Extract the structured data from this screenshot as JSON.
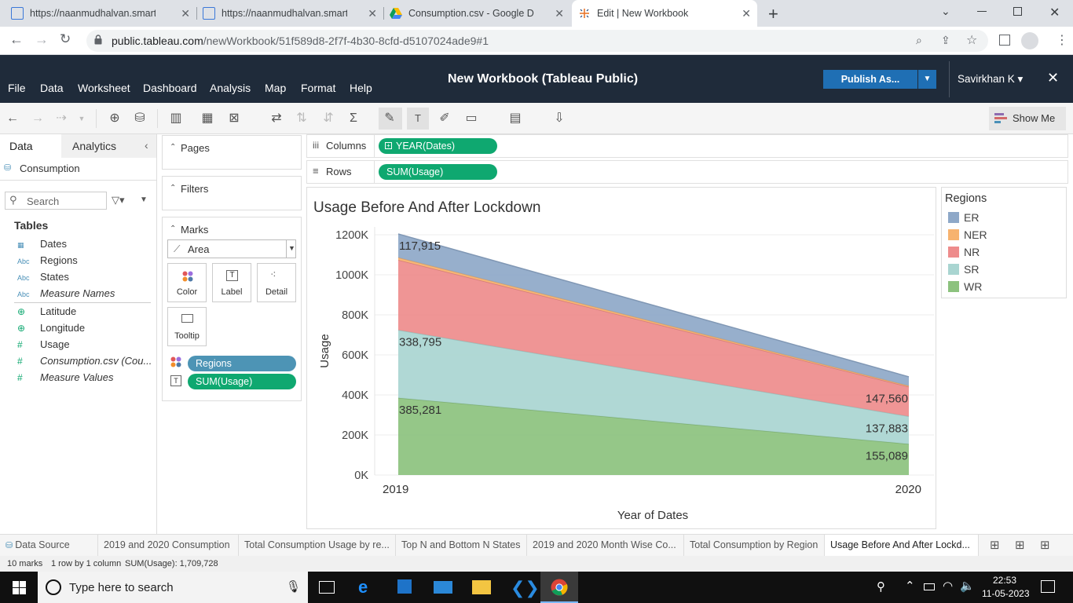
{
  "browser": {
    "tabs": [
      {
        "title": "https://naanmudhalvan.smartinte"
      },
      {
        "title": "https://naanmudhalvan.smartinte"
      },
      {
        "title": "Consumption.csv - Google Drive"
      },
      {
        "title": "Edit | New Workbook"
      }
    ],
    "url_domain": "public.tableau.com",
    "url_path": "/newWorkbook/51f589d8-2f7f-4b30-8cfd-d5107024ade9#1"
  },
  "app": {
    "title": "New Workbook (Tableau Public)",
    "publish_label": "Publish As...",
    "user": "Savirkhan K",
    "menu": [
      "File",
      "Data",
      "Worksheet",
      "Dashboard",
      "Analysis",
      "Map",
      "Format",
      "Help"
    ],
    "show_me": "Show Me"
  },
  "datapane": {
    "tab_data": "Data",
    "tab_analytics": "Analytics",
    "source": "Consumption",
    "search_placeholder": "Search",
    "tables_label": "Tables",
    "fields": [
      {
        "name": "Dates",
        "type": "date"
      },
      {
        "name": "Regions",
        "type": "Abc"
      },
      {
        "name": "States",
        "type": "Abc"
      },
      {
        "name": "Measure Names",
        "type": "Abc",
        "italic": true
      },
      {
        "name": "Latitude",
        "type": "geo"
      },
      {
        "name": "Longitude",
        "type": "geo"
      },
      {
        "name": "Usage",
        "type": "#"
      },
      {
        "name": "Consumption.csv (Cou...",
        "type": "#",
        "italic": true
      },
      {
        "name": "Measure Values",
        "type": "#",
        "italic": true
      }
    ]
  },
  "cards": {
    "pages": "Pages",
    "filters": "Filters",
    "marks": "Marks",
    "mark_type": "Area",
    "buttons": {
      "color": "Color",
      "label": "Label",
      "detail": "Detail",
      "tooltip": "Tooltip"
    },
    "pill_regions": "Regions",
    "pill_usage": "SUM(Usage)"
  },
  "shelves": {
    "columns_label": "Columns",
    "columns_pill": "YEAR(Dates)",
    "rows_label": "Rows",
    "rows_pill": "SUM(Usage)"
  },
  "colors": {
    "pill_green": "#0fa870",
    "pill_blue": "#4d94b5",
    "header_bg": "#1f2b3a",
    "publish_blue": "#1f6fb4"
  },
  "chart_data": {
    "type": "area",
    "title": "Usage Before  And After Lockdown",
    "xlabel": "Year of Dates",
    "ylabel": "Usage",
    "ylim": [
      0,
      1200000
    ],
    "yticks": [
      "0K",
      "200K",
      "400K",
      "600K",
      "800K",
      "1000K",
      "1200K"
    ],
    "categories": [
      "2019",
      "2020"
    ],
    "stacked": true,
    "series": [
      {
        "name": "WR",
        "color": "#8cc27e",
        "values": [
          385281,
          155089
        ],
        "labels": [
          "385,281",
          "155,089"
        ]
      },
      {
        "name": "SR",
        "color": "#a9d5d1",
        "values": [
          338795,
          137883
        ],
        "labels": [
          "338,795",
          "137,883"
        ]
      },
      {
        "name": "NR",
        "color": "#ee8c8c",
        "values": [
          350000,
          147560
        ],
        "labels": [
          "",
          "147,560"
        ]
      },
      {
        "name": "NER",
        "color": "#f7b36f",
        "values": [
          12000,
          5000
        ],
        "labels": [
          "",
          ""
        ]
      },
      {
        "name": "ER",
        "color": "#8ea8c8",
        "values": [
          117915,
          45000
        ],
        "labels": [
          "117,915",
          ""
        ]
      }
    ],
    "legend": {
      "title": "Regions",
      "items": [
        {
          "name": "ER",
          "color": "#8ea8c8"
        },
        {
          "name": "NER",
          "color": "#f7b36f"
        },
        {
          "name": "NR",
          "color": "#ee8c8c"
        },
        {
          "name": "SR",
          "color": "#a9d5d1"
        },
        {
          "name": "WR",
          "color": "#8cc27e"
        }
      ]
    }
  },
  "sheets": [
    {
      "label": "Data Source"
    },
    {
      "label": "2019 and 2020 Consumption"
    },
    {
      "label": "Total Consumption Usage by re..."
    },
    {
      "label": "Top N and Bottom N States"
    },
    {
      "label": "2019 and 2020 Month Wise Co..."
    },
    {
      "label": "Total Consumption by Region"
    },
    {
      "label": "Usage Before And After Lockd..."
    }
  ],
  "status": {
    "marks": "10 marks",
    "rows_cols": "1 row by 1 column",
    "sum": "SUM(Usage): 1,709,728"
  },
  "taskbar": {
    "search_placeholder": "Type here to search",
    "time": "22:53",
    "date": "11-05-2023"
  }
}
